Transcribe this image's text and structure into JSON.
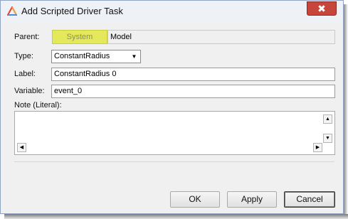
{
  "window": {
    "title": "Add Scripted Driver Task",
    "close_glyph": "✖"
  },
  "colors": {
    "close_button": "#c7453a",
    "parent_button": "#e4e85b"
  },
  "form": {
    "parent": {
      "label": "Parent:",
      "button_label": "System",
      "value": "Model"
    },
    "type": {
      "label": "Type:",
      "value": "ConstantRadius",
      "arrow": "▼"
    },
    "label_field": {
      "label": "Label:",
      "value": "ConstantRadius 0"
    },
    "variable": {
      "label": "Variable:",
      "value": "event_0"
    },
    "note": {
      "label": "Note (Literal):",
      "value": ""
    }
  },
  "scrollbar": {
    "up": "▲",
    "down": "▼",
    "left": "◀",
    "right": "▶"
  },
  "buttons": {
    "ok": "OK",
    "apply": "Apply",
    "cancel": "Cancel"
  },
  "icons": {
    "app": "altair-triangle-icon",
    "close": "close-icon"
  }
}
